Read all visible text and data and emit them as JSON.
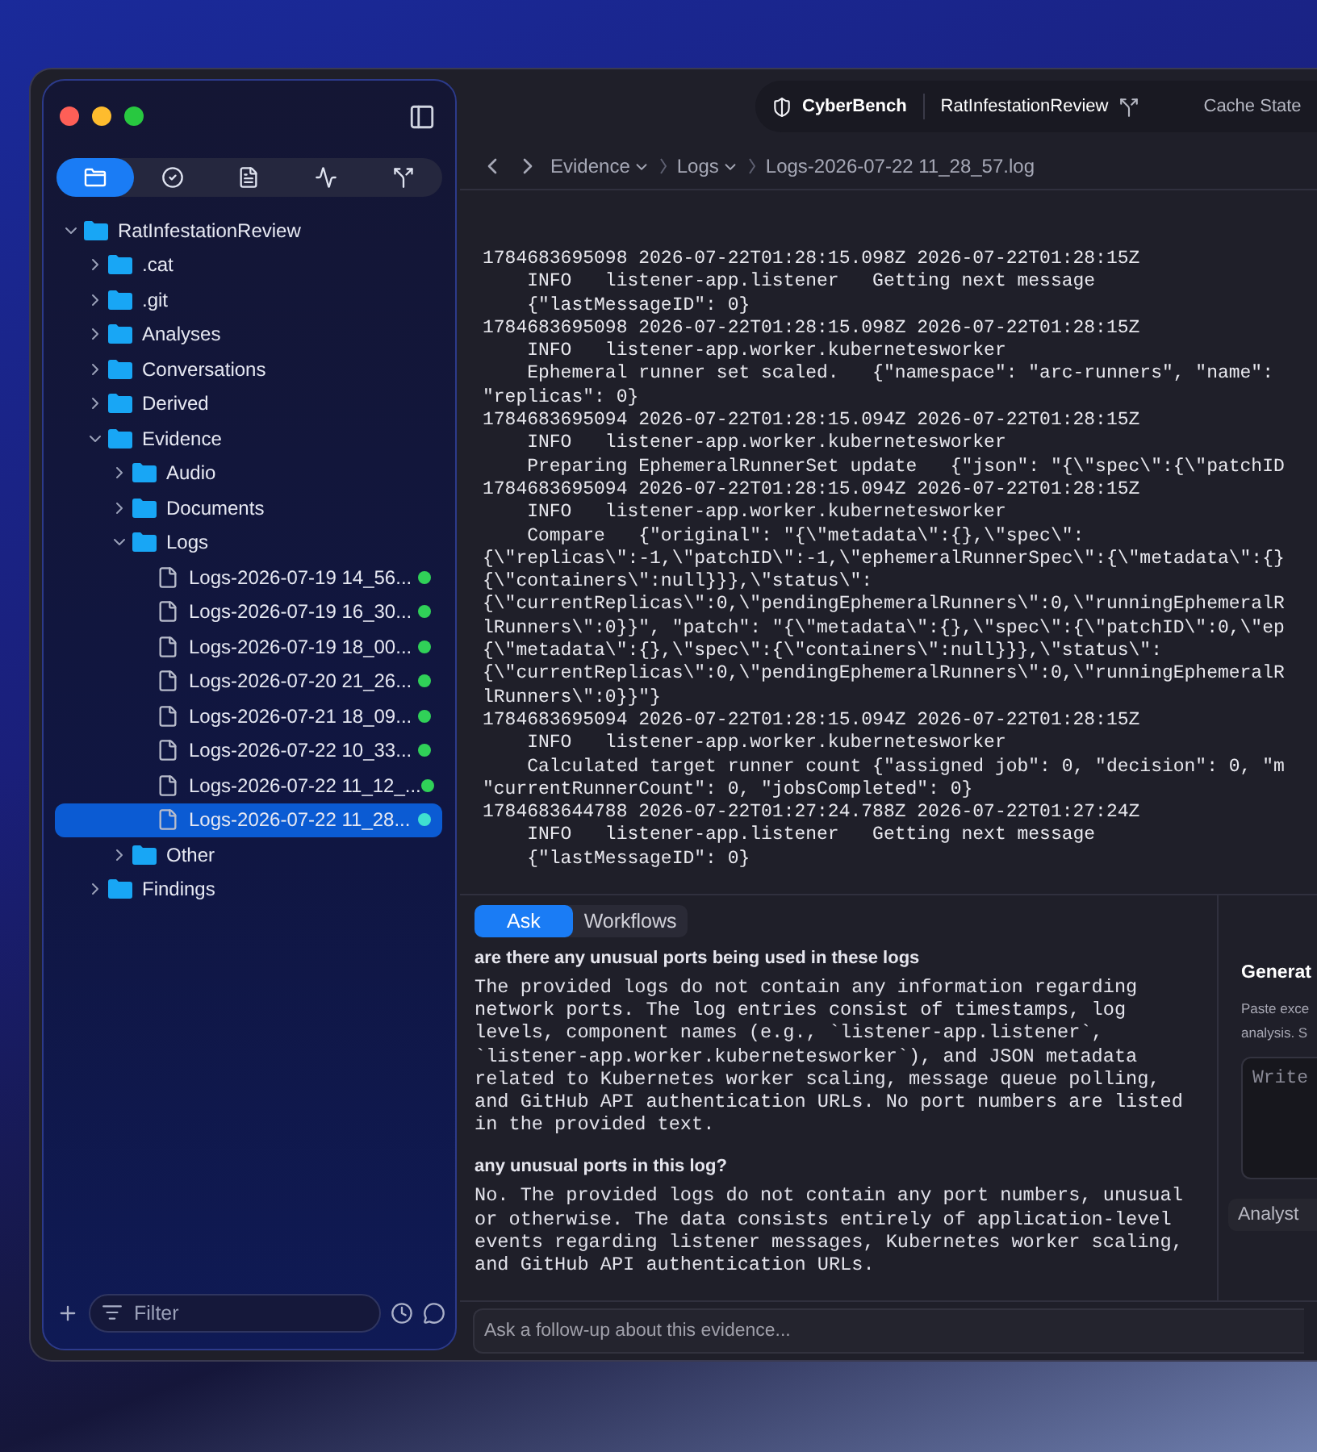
{
  "sidebar": {
    "tabs": [
      {
        "kind": "files",
        "selected": true
      },
      {
        "kind": "checks",
        "selected": false
      },
      {
        "kind": "document",
        "selected": false
      },
      {
        "kind": "activity",
        "selected": false
      },
      {
        "kind": "branches",
        "selected": false
      }
    ],
    "tree": [
      {
        "name": "RatInfestationReview",
        "kind": "folder",
        "expanded": true,
        "selected": false,
        "children": [
          {
            "name": ".cat",
            "kind": "folder",
            "expanded": false,
            "selected": false
          },
          {
            "name": ".git",
            "kind": "folder",
            "expanded": false,
            "selected": false
          },
          {
            "name": "Analyses",
            "kind": "folder",
            "expanded": false,
            "selected": false
          },
          {
            "name": "Conversations",
            "kind": "folder",
            "expanded": false,
            "selected": false
          },
          {
            "name": "Derived",
            "kind": "folder",
            "expanded": false,
            "selected": false
          },
          {
            "name": "Evidence",
            "kind": "folder",
            "expanded": true,
            "selected": false,
            "children": [
              {
                "name": "Audio",
                "kind": "folder",
                "expanded": false,
                "selected": false
              },
              {
                "name": "Documents",
                "kind": "folder",
                "expanded": false,
                "selected": false
              },
              {
                "name": "Logs",
                "kind": "folder",
                "expanded": true,
                "selected": false,
                "children": [
                  {
                    "name": "Logs-2026-07-19 14_56...",
                    "kind": "file",
                    "selected": false,
                    "color": "#30d158"
                  },
                  {
                    "name": "Logs-2026-07-19 16_30...",
                    "kind": "file",
                    "selected": false,
                    "color": "#30d158"
                  },
                  {
                    "name": "Logs-2026-07-19 18_00...",
                    "kind": "file",
                    "selected": false,
                    "color": "#30d158"
                  },
                  {
                    "name": "Logs-2026-07-20 21_26...",
                    "kind": "file",
                    "selected": false,
                    "color": "#30d158"
                  },
                  {
                    "name": "Logs-2026-07-21 18_09...",
                    "kind": "file",
                    "selected": false,
                    "color": "#30d158"
                  },
                  {
                    "name": "Logs-2026-07-22 10_33...",
                    "kind": "file",
                    "selected": false,
                    "color": "#30d158"
                  },
                  {
                    "name": "Logs-2026-07-22 11_12_...",
                    "kind": "file",
                    "selected": false,
                    "color": "#30d158"
                  },
                  {
                    "name": "Logs-2026-07-22 11_28...",
                    "kind": "file",
                    "selected": true,
                    "color": "#40e0d0"
                  }
                ]
              },
              {
                "name": "Other",
                "kind": "folder",
                "expanded": false,
                "selected": false
              }
            ]
          },
          {
            "name": "Findings",
            "kind": "folder",
            "expanded": false,
            "selected": false
          }
        ]
      }
    ],
    "filter": {
      "placeholder": "Filter"
    }
  },
  "toolbar": {
    "app": "CyberBench",
    "project": "RatInfestationReview",
    "status": "Cache State"
  },
  "breadcrumb": [
    {
      "label": "Evidence",
      "menu": true
    },
    {
      "label": "Logs",
      "menu": true
    },
    {
      "label": "Logs-2026-07-22 11_28_57.log",
      "menu": false
    }
  ],
  "log_lines": [
    "1784683695098 2026-07-22T01:28:15.098Z 2026-07-22T01:28:15Z",
    "    INFO   listener-app.listener   Getting next message",
    "    {\"lastMessageID\": 0}",
    "1784683695098 2026-07-22T01:28:15.098Z 2026-07-22T01:28:15Z",
    "    INFO   listener-app.worker.kubernetesworker",
    "    Ephemeral runner set scaled.   {\"namespace\": \"arc-runners\", \"name\":",
    "\"replicas\": 0}",
    "1784683695094 2026-07-22T01:28:15.094Z 2026-07-22T01:28:15Z",
    "    INFO   listener-app.worker.kubernetesworker",
    "    Preparing EphemeralRunnerSet update   {\"json\": \"{\\\"spec\\\":{\\\"patchID",
    "1784683695094 2026-07-22T01:28:15.094Z 2026-07-22T01:28:15Z",
    "    INFO   listener-app.worker.kubernetesworker",
    "    Compare   {\"original\": \"{\\\"metadata\\\":{},\\\"spec\\\":",
    "{\\\"replicas\\\":-1,\\\"patchID\\\":-1,\\\"ephemeralRunnerSpec\\\":{\\\"metadata\\\":{}",
    "{\\\"containers\\\":null}}},\\\"status\\\":",
    "{\\\"currentReplicas\\\":0,\\\"pendingEphemeralRunners\\\":0,\\\"runningEphemeralR",
    "lRunners\\\":0}}\", \"patch\": \"{\\\"metadata\\\":{},\\\"spec\\\":{\\\"patchID\\\":0,\\\"ep",
    "{\\\"metadata\\\":{},\\\"spec\\\":{\\\"containers\\\":null}}},\\\"status\\\":",
    "{\\\"currentReplicas\\\":0,\\\"pendingEphemeralRunners\\\":0,\\\"runningEphemeralR",
    "lRunners\\\":0}}\"}",
    "1784683695094 2026-07-22T01:28:15.094Z 2026-07-22T01:28:15Z",
    "    INFO   listener-app.worker.kubernetesworker",
    "    Calculated target runner count {\"assigned job\": 0, \"decision\": 0, \"m",
    "\"currentRunnerCount\": 0, \"jobsCompleted\": 0}",
    "1784683644788 2026-07-22T01:27:24.788Z 2026-07-22T01:27:24Z",
    "    INFO   listener-app.listener   Getting next message",
    "    {\"lastMessageID\": 0}"
  ],
  "chat": {
    "tabs": [
      {
        "label": "Ask",
        "selected": true
      },
      {
        "label": "Workflows",
        "selected": false
      }
    ],
    "messages": [
      {
        "question": "are there any unusual ports being used in these logs",
        "answer": "The provided logs do not contain any information regarding network ports. The log entries consist of timestamps, log levels, component names (e.g., `listener-app.listener`, `listener-app.worker.kubernetesworker`), and JSON metadata related to Kubernetes worker scaling, message queue polling, and GitHub API authentication URLs. No port numbers are listed in the provided text."
      },
      {
        "question": "any unusual ports in this log?",
        "answer": "No. The provided logs do not contain any port numbers, unusual or otherwise. The data consists entirely of application-level events regarding listener messages, Kubernetes worker scaling, and GitHub API authentication URLs."
      }
    ],
    "input": {
      "placeholder": "Ask a follow-up about this evidence..."
    }
  },
  "side_panel": {
    "title": "Generat",
    "hint_lines": [
      "Paste exce",
      "analysis. S"
    ],
    "field": {
      "placeholder": "Write"
    },
    "button": "Analyst"
  }
}
